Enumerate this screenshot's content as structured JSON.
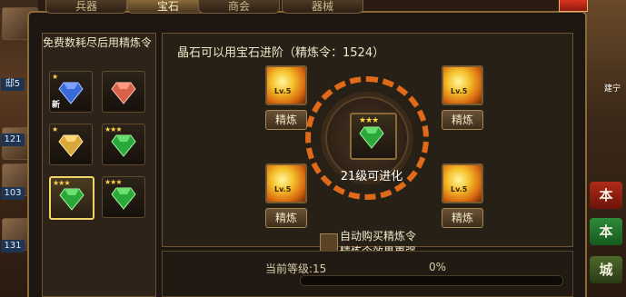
{
  "tabs": [
    {
      "label": "兵器",
      "active": false
    },
    {
      "label": "宝石",
      "active": true
    },
    {
      "label": "商会",
      "active": false
    },
    {
      "label": "器械",
      "active": false
    }
  ],
  "left_panel": {
    "title": "免费数耗尽后用精炼令",
    "gems": [
      {
        "color": "blue",
        "stars": "★",
        "tag": "新",
        "selected": false
      },
      {
        "color": "red",
        "stars": "",
        "tag": "",
        "selected": false
      },
      {
        "color": "gold",
        "stars": "★",
        "tag": "",
        "selected": false
      },
      {
        "color": "green",
        "stars": "★★★",
        "tag": "",
        "selected": false
      },
      {
        "color": "green",
        "stars": "★★★",
        "tag": "",
        "selected": true
      },
      {
        "color": "green",
        "stars": "★★★",
        "tag": "",
        "selected": false
      }
    ]
  },
  "main": {
    "info": "晶石可以用宝石进阶（精炼令：1524）",
    "center_stars": "★★★",
    "center_label": "21级可进化",
    "slots": [
      {
        "level": "Lv.5",
        "button": "精炼"
      },
      {
        "level": "Lv.5",
        "button": "精炼"
      },
      {
        "level": "Lv.5",
        "button": "精炼"
      },
      {
        "level": "Lv.5",
        "button": "精炼"
      }
    ],
    "auto_buy_line1": "自动购买精炼令",
    "auto_buy_line2": "精炼令效果更强",
    "level_label": "当前等级:15",
    "progress_text": "0%",
    "progress": 0
  },
  "sidebar_left": {
    "levels": [
      "邸5",
      "121",
      "103",
      "131"
    ]
  },
  "sidebar_right": {
    "buttons": [
      "本",
      "本",
      "城"
    ],
    "map_label": "建宁"
  },
  "colors": {
    "accent": "#e06a1a",
    "border": "#8b6a3a",
    "text": "#f0e6c8"
  }
}
